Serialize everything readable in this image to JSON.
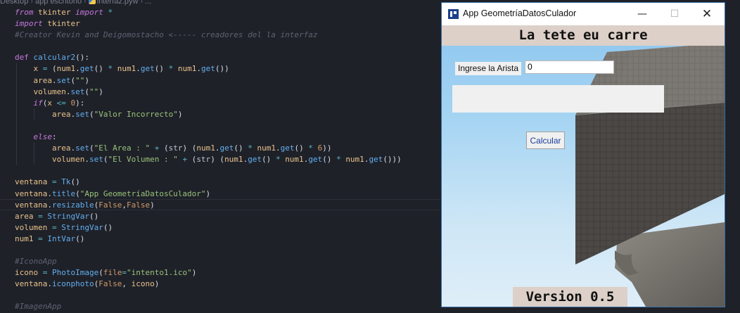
{
  "editor": {
    "breadcrumb": [
      "Desktop",
      "app escritorio",
      "interfaz.pyw",
      "..."
    ],
    "lines": [
      "from tkinter import *",
      "import tkinter",
      "#Creator Kevin and Deigomostacho <----- creadores del la interfaz",
      "",
      "def calcular2():",
      "    x = (num1.get() * num1.get() * num1.get())",
      "    area.set(\"\")",
      "    volumen.set(\"\")",
      "    if(x <= 0):",
      "        area.set(\"Valor Incorrecto\")",
      "",
      "    else:",
      "        area.set(\"El Area : \" + (str) (num1.get() * num1.get() * 6))",
      "        volumen.set(\"El Volumen : \" + (str) (num1.get() * num1.get() * num1.get()))",
      "",
      "ventana = Tk()",
      "ventana.title(\"App GeometríaDatosCulador\")",
      "ventana.resizable(False,False)",
      "area = StringVar()",
      "volumen = StringVar()",
      "num1 = IntVar()",
      "",
      "#IconoApp",
      "icono = PhotoImage(file=\"intento1.ico\")",
      "ventana.iconphoto(False, icono)",
      "",
      "#ImagenApp"
    ]
  },
  "window": {
    "title": "App GeometríaDatosCulador",
    "minimize": "—",
    "maximize": "☐",
    "close": "✕",
    "header": "La tete eu carre",
    "label_arista": "Ingrese la Arista",
    "entry_value": "0",
    "result_text": "",
    "calc_button": "Calcular",
    "version": "Version 0.5"
  },
  "colors": {
    "editor_bg": "#1f2129",
    "keyword": "#c678dd",
    "string": "#98c379",
    "function": "#61afef",
    "comment": "#5c6370",
    "header_bar": "#dcd0c8"
  }
}
